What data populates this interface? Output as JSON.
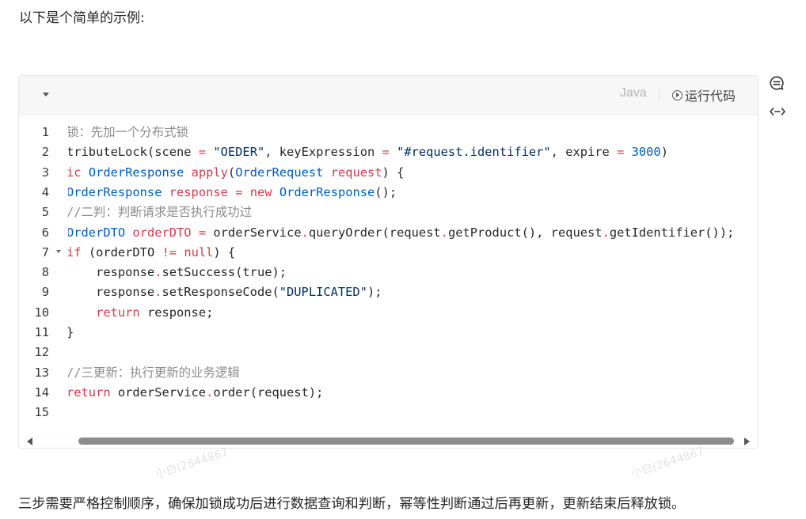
{
  "intro_text": "以下是个简单的示例:",
  "code_block": {
    "language": "Java",
    "run_label": "运行代码",
    "lines": [
      {
        "num": "1",
        "fold": false,
        "tokens": [
          {
            "t": "锁：先加一个分布式锁",
            "c": "comment"
          }
        ]
      },
      {
        "num": "2",
        "fold": false,
        "tokens": [
          {
            "t": "tributeLock(scene ",
            "c": "plain"
          },
          {
            "t": "=",
            "c": "op"
          },
          {
            "t": " ",
            "c": "plain"
          },
          {
            "t": "\"OEDER\"",
            "c": "string"
          },
          {
            "t": ", keyExpression ",
            "c": "plain"
          },
          {
            "t": "=",
            "c": "op"
          },
          {
            "t": " ",
            "c": "plain"
          },
          {
            "t": "\"#request.identifier\"",
            "c": "string"
          },
          {
            "t": ", expire ",
            "c": "plain"
          },
          {
            "t": "=",
            "c": "op"
          },
          {
            "t": " ",
            "c": "plain"
          },
          {
            "t": "3000",
            "c": "number"
          },
          {
            "t": ")",
            "c": "plain"
          }
        ]
      },
      {
        "num": "3",
        "fold": false,
        "tokens": [
          {
            "t": "ic ",
            "c": "keyword"
          },
          {
            "t": "OrderResponse",
            "c": "type"
          },
          {
            "t": " ",
            "c": "plain"
          },
          {
            "t": "apply",
            "c": "method"
          },
          {
            "t": "(",
            "c": "plain"
          },
          {
            "t": "OrderRequest",
            "c": "type"
          },
          {
            "t": " ",
            "c": "plain"
          },
          {
            "t": "request",
            "c": "method"
          },
          {
            "t": ") {",
            "c": "plain"
          }
        ]
      },
      {
        "num": "4",
        "fold": false,
        "tokens": [
          {
            "t": "OrderResponse",
            "c": "type"
          },
          {
            "t": " ",
            "c": "plain"
          },
          {
            "t": "response",
            "c": "method"
          },
          {
            "t": " ",
            "c": "plain"
          },
          {
            "t": "=",
            "c": "op"
          },
          {
            "t": " ",
            "c": "plain"
          },
          {
            "t": "new",
            "c": "keyword"
          },
          {
            "t": " ",
            "c": "plain"
          },
          {
            "t": "OrderResponse",
            "c": "type"
          },
          {
            "t": "();",
            "c": "plain"
          }
        ]
      },
      {
        "num": "5",
        "fold": false,
        "tokens": [
          {
            "t": "//二判：判断请求是否执行成功过",
            "c": "comment"
          }
        ]
      },
      {
        "num": "6",
        "fold": false,
        "tokens": [
          {
            "t": "OrderDTO",
            "c": "type"
          },
          {
            "t": " ",
            "c": "plain"
          },
          {
            "t": "orderDTO",
            "c": "method"
          },
          {
            "t": " ",
            "c": "plain"
          },
          {
            "t": "=",
            "c": "op"
          },
          {
            "t": " orderService",
            "c": "plain"
          },
          {
            "t": ".",
            "c": "op"
          },
          {
            "t": "queryOrder(request",
            "c": "plain"
          },
          {
            "t": ".",
            "c": "op"
          },
          {
            "t": "getProduct(), request",
            "c": "plain"
          },
          {
            "t": ".",
            "c": "op"
          },
          {
            "t": "getIdentifier());",
            "c": "plain"
          }
        ]
      },
      {
        "num": "7",
        "fold": true,
        "tokens": [
          {
            "t": "if",
            "c": "keyword"
          },
          {
            "t": " (orderDTO ",
            "c": "plain"
          },
          {
            "t": "!=",
            "c": "op"
          },
          {
            "t": " ",
            "c": "plain"
          },
          {
            "t": "null",
            "c": "keyword"
          },
          {
            "t": ") {",
            "c": "plain"
          }
        ]
      },
      {
        "num": "8",
        "fold": false,
        "tokens": [
          {
            "t": "    response",
            "c": "plain"
          },
          {
            "t": ".",
            "c": "op"
          },
          {
            "t": "setSuccess(true);",
            "c": "plain"
          }
        ]
      },
      {
        "num": "9",
        "fold": false,
        "tokens": [
          {
            "t": "    response",
            "c": "plain"
          },
          {
            "t": ".",
            "c": "op"
          },
          {
            "t": "setResponseCode(",
            "c": "plain"
          },
          {
            "t": "\"DUPLICATED\"",
            "c": "string"
          },
          {
            "t": ");",
            "c": "plain"
          }
        ]
      },
      {
        "num": "10",
        "fold": false,
        "tokens": [
          {
            "t": "    ",
            "c": "plain"
          },
          {
            "t": "return",
            "c": "keyword"
          },
          {
            "t": " response;",
            "c": "plain"
          }
        ]
      },
      {
        "num": "11",
        "fold": false,
        "tokens": [
          {
            "t": "}",
            "c": "plain"
          }
        ]
      },
      {
        "num": "12",
        "fold": false,
        "tokens": []
      },
      {
        "num": "13",
        "fold": false,
        "tokens": [
          {
            "t": "//三更新：执行更新的业务逻辑",
            "c": "comment"
          }
        ]
      },
      {
        "num": "14",
        "fold": false,
        "tokens": [
          {
            "t": "return",
            "c": "keyword"
          },
          {
            "t": " orderService",
            "c": "plain"
          },
          {
            "t": ".",
            "c": "op"
          },
          {
            "t": "order(request);",
            "c": "plain"
          }
        ]
      },
      {
        "num": "15",
        "fold": false,
        "tokens": []
      }
    ]
  },
  "watermark_text": "小白(2644867",
  "summary_text": "三步需要严格控制顺序，确保加锁成功后进行数据查询和判断，幂等性判断通过后再更新，更新结束后释放锁。",
  "colors": {
    "comment": "#8c8c8c",
    "keyword": "#d73a49",
    "type": "#005cc5",
    "string": "#032f62",
    "number": "#005cc5",
    "method": "#d73a49",
    "op": "#d73a49",
    "plain": "#262626"
  }
}
